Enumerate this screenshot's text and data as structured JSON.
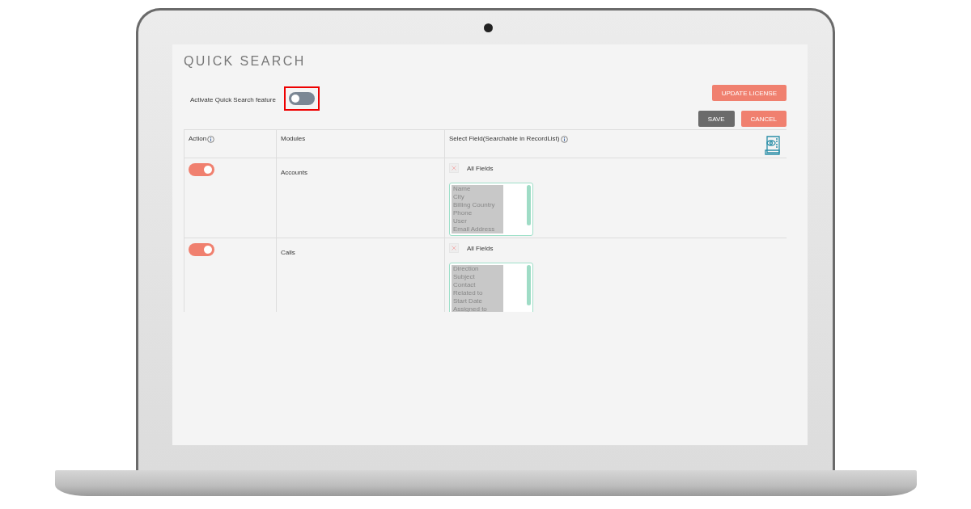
{
  "page": {
    "title": "QUICK SEARCH"
  },
  "activate": {
    "label": "Activate Quick Search feature",
    "on": false,
    "highlighted": true
  },
  "license_button": {
    "label": "UPDATE LICENSE",
    "kind": "primary"
  },
  "actions": [
    {
      "label": "SAVE",
      "kind": "secondary"
    },
    {
      "label": "CANCEL",
      "kind": "primary"
    }
  ],
  "table": {
    "columns": [
      {
        "label": "Action",
        "info": true
      },
      {
        "label": "Modules",
        "info": false
      },
      {
        "label": "Select Field(Searchable in RecordList)",
        "info": true
      }
    ],
    "rows": [
      {
        "enabled": true,
        "module": "Accounts",
        "all_fields": {
          "label": "All Fields",
          "checked": false
        },
        "fields": [
          {
            "label": "Name",
            "selected": true
          },
          {
            "label": "City",
            "selected": true
          },
          {
            "label": "Billing Country",
            "selected": true
          },
          {
            "label": "Phone",
            "selected": true
          },
          {
            "label": "User",
            "selected": true
          },
          {
            "label": "Email Address",
            "selected": true
          }
        ]
      },
      {
        "enabled": true,
        "module": "Calls",
        "all_fields": {
          "label": "All Fields",
          "checked": false
        },
        "fields": [
          {
            "label": "Direction",
            "selected": true
          },
          {
            "label": "Subject",
            "selected": true
          },
          {
            "label": "Contact",
            "selected": true
          },
          {
            "label": "Related to",
            "selected": true
          },
          {
            "label": "Start Date",
            "selected": true
          },
          {
            "label": "Assigned to",
            "selected": true
          }
        ]
      }
    ]
  }
}
